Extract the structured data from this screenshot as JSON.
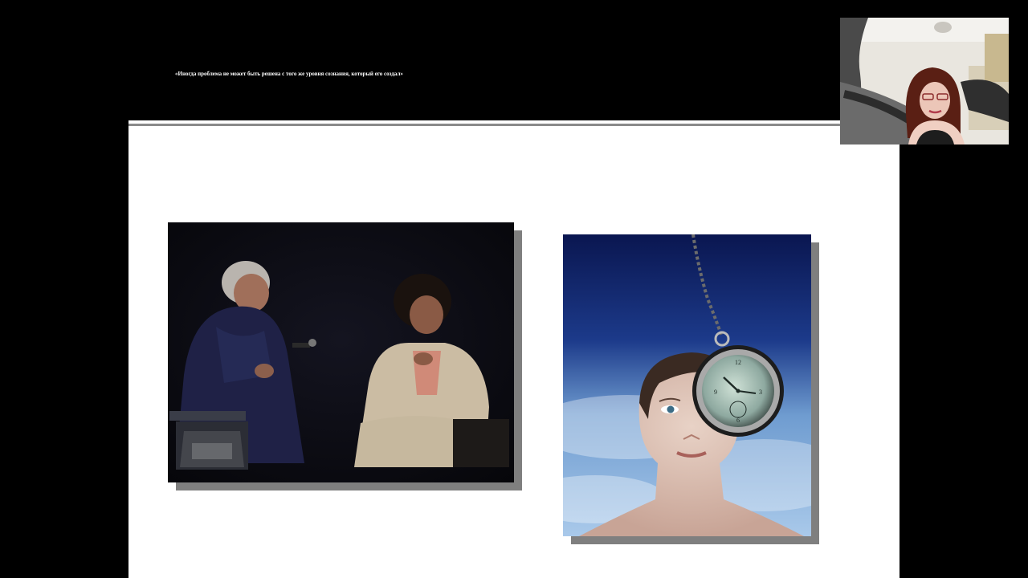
{
  "slide": {
    "quote": "«Иногда проблема не может быть решена с того же уровня сознания, который его создал»"
  },
  "images": {
    "interview_photo": "interview-photo",
    "hypnosis_photo": "hypnosis-pocket-watch-photo"
  },
  "webcam": {
    "label": "presenter-video"
  },
  "colors": {
    "background": "#000000",
    "slide_body": "#ffffff",
    "shadow": "#7f7f7f",
    "rule": "#8a8a8a"
  }
}
